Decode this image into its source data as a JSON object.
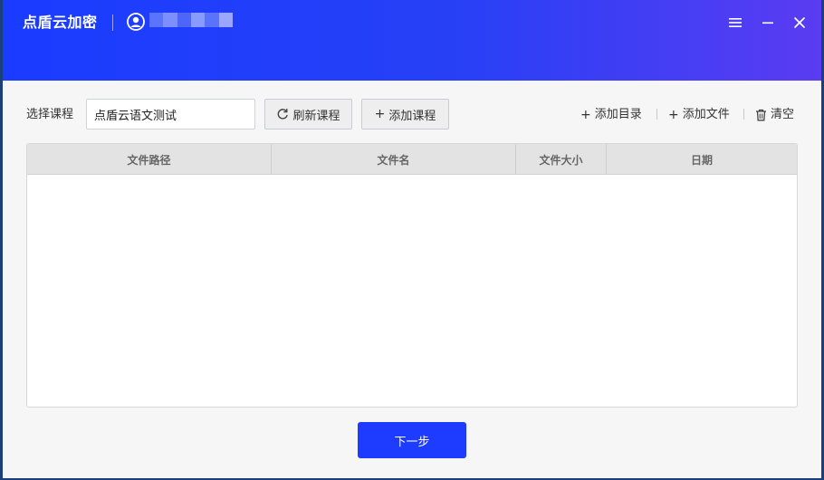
{
  "app": {
    "title": "点盾云加密"
  },
  "toolbar": {
    "course_label": "选择课程",
    "course_value": "点盾云语文测试",
    "refresh_label": "刷新课程",
    "add_course_label": "添加课程",
    "add_dir_label": "添加目录",
    "add_file_label": "添加文件",
    "clear_label": "清空"
  },
  "table": {
    "columns": [
      "文件路径",
      "文件名",
      "文件大小",
      "日期"
    ],
    "rows": []
  },
  "footer": {
    "next_label": "下一步"
  },
  "icons": {
    "user": "user-icon",
    "menu": "menu-icon",
    "minimize": "minimize-icon",
    "close": "close-icon",
    "refresh": "refresh-icon",
    "trash": "trash-icon"
  },
  "colors": {
    "header_start": "#1a3cff",
    "header_end": "#5a3cf2",
    "primary_button": "#1e3cff"
  }
}
